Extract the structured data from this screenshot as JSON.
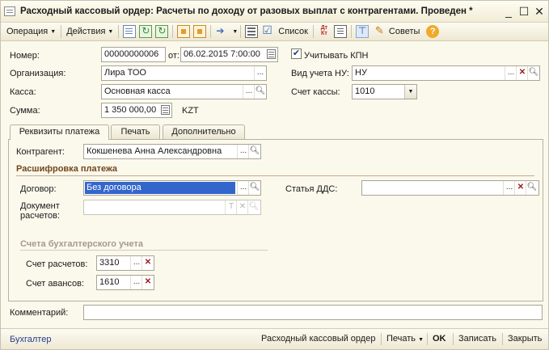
{
  "window": {
    "title": "Расходный кассовый ордер: Расчеты по доходу от разовых выплат с контрагентами. Проведен *",
    "minimize": "_",
    "maximize": "☐",
    "close": "✕"
  },
  "toolbar": {
    "operation_label": "Операция",
    "actions_label": "Действия",
    "list_label": "Список",
    "dtkt_top": "Дт",
    "dtkt_bottom": "Кт",
    "advice_label": "Советы",
    "help_label": "?"
  },
  "header": {
    "number_label": "Номер:",
    "number_value": "00000000006",
    "date_label": "от:",
    "date_value": "06.02.2015  7:00:00",
    "kpn_label": "Учитывать КПН",
    "kpn_checked": true,
    "org_label": "Организация:",
    "org_value": "Лира ТОО",
    "nu_label": "Вид учета НУ:",
    "nu_value": "НУ",
    "kassa_label": "Касса:",
    "kassa_value": "Основная касса",
    "kassa_account_label": "Счет кассы:",
    "kassa_account_value": "1010",
    "sum_label": "Сумма:",
    "sum_value": "1 350 000,00",
    "currency": "KZT"
  },
  "tabs": [
    {
      "label": "Реквизиты платежа",
      "active": true
    },
    {
      "label": "Печать",
      "active": false
    },
    {
      "label": "Дополнительно",
      "active": false
    }
  ],
  "payment": {
    "counterparty_label": "Контрагент:",
    "counterparty_value": "Кокшенева Анна Александровна",
    "breakdown_title": "Расшифровка платежа",
    "contract_label": "Договор:",
    "contract_value": "Без договора",
    "dds_label": "Статья ДДС:",
    "dds_value": "",
    "settlement_doc_label_1": "Документ",
    "settlement_doc_label_2": "расчетов:",
    "settlement_doc_value": "",
    "accounts_title": "Счета бухгалтерского учета",
    "settlement_account_label": "Счет расчетов:",
    "settlement_account_value": "3310",
    "advance_account_label": "Счет авансов:",
    "advance_account_value": "1610"
  },
  "comment": {
    "label": "Комментарий:",
    "value": ""
  },
  "statusbar": {
    "user": "Бухгалтер",
    "doc_print": "Расходный кассовый ордер",
    "print_label": "Печать",
    "ok_label": "OK",
    "save_label": "Записать",
    "close_label": "Закрыть"
  }
}
